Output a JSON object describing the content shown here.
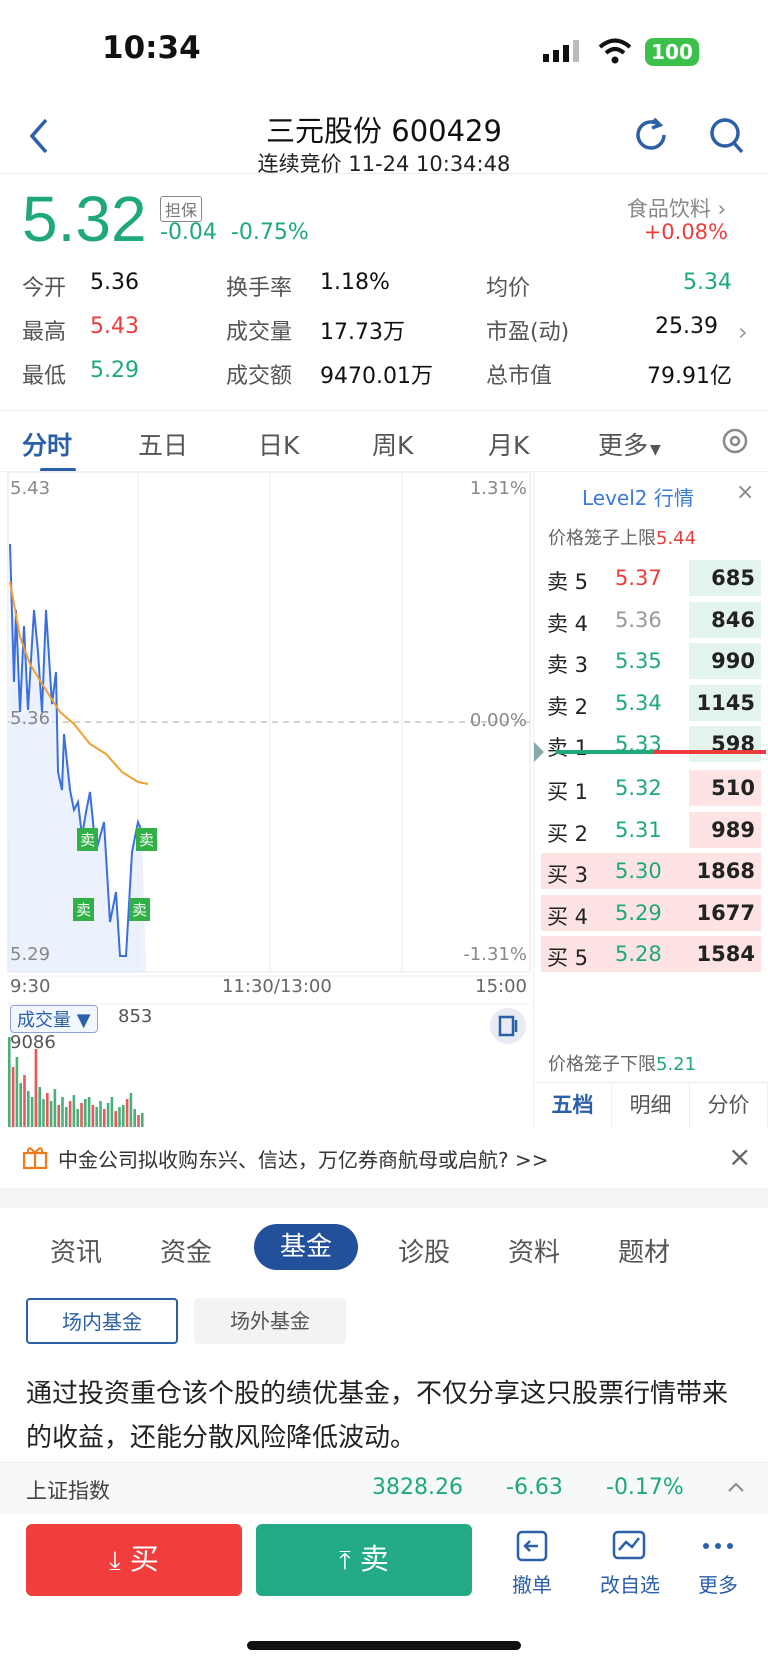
{
  "status": {
    "time": "10:34",
    "battery": "100"
  },
  "nav": {
    "title": "三元股份 600429",
    "subtitle": "连续竞价 11-24 10:34:48"
  },
  "quote": {
    "price": "5.32",
    "tag": "担保",
    "change": "-0.04",
    "change_pct": "-0.75%",
    "sector": "食品饮料",
    "sector_pct": "+0.08%"
  },
  "stats": [
    {
      "label": "今开",
      "value": "5.36",
      "color": "#111111"
    },
    {
      "label": "换手率",
      "value": "1.18%",
      "color": "#111111"
    },
    {
      "label": "均价",
      "value": "5.34",
      "color": "#1fa87a"
    },
    {
      "label": "最高",
      "value": "5.43",
      "color": "#ee3b3b"
    },
    {
      "label": "成交量",
      "value": "17.73万",
      "color": "#111111"
    },
    {
      "label": "市盈(动)",
      "value": "25.39",
      "color": "#111111"
    },
    {
      "label": "最低",
      "value": "5.29",
      "color": "#1fa87a"
    },
    {
      "label": "成交额",
      "value": "9470.01万",
      "color": "#111111"
    },
    {
      "label": "总市值",
      "value": "79.91亿",
      "color": "#111111"
    }
  ],
  "chart_tabs": [
    "分时",
    "五日",
    "日K",
    "周K",
    "月K",
    "更多"
  ],
  "chart": {
    "y_max": "5.43",
    "y_mid": "5.36",
    "y_min": "5.29",
    "pct_max": "1.31%",
    "pct_mid": "0.00%",
    "pct_min": "-1.31%",
    "t_start": "9:30",
    "t_mid": "11:30/13:00",
    "t_end": "15:00",
    "sell_mark": "卖",
    "vol_label": "成交量",
    "vol_value": "853",
    "vol_max": "9086"
  },
  "orderbook": {
    "title": "Level2 行情",
    "upper_label": "价格笼子上限",
    "upper": "5.44",
    "lower_label": "价格笼子下限",
    "lower": "5.21",
    "asks": [
      {
        "label": "卖 5",
        "price": "5.37",
        "vol": "685",
        "pc": "#ee3b3b"
      },
      {
        "label": "卖 4",
        "price": "5.36",
        "vol": "846",
        "pc": "#999999"
      },
      {
        "label": "卖 3",
        "price": "5.35",
        "vol": "990",
        "pc": "#1fa87a"
      },
      {
        "label": "卖 2",
        "price": "5.34",
        "vol": "1145",
        "pc": "#1fa87a"
      },
      {
        "label": "卖 1",
        "price": "5.33",
        "vol": "598",
        "pc": "#1fa87a"
      }
    ],
    "bids": [
      {
        "label": "买 1",
        "price": "5.32",
        "vol": "510"
      },
      {
        "label": "买 2",
        "price": "5.31",
        "vol": "989"
      },
      {
        "label": "买 3",
        "price": "5.30",
        "vol": "1868"
      },
      {
        "label": "买 4",
        "price": "5.29",
        "vol": "1677"
      },
      {
        "label": "买 5",
        "price": "5.28",
        "vol": "1584"
      }
    ],
    "tabs": [
      "五档",
      "明细",
      "分价"
    ]
  },
  "news": {
    "text": "中金公司拟收购东兴、信达，万亿券商航母或启航? >>"
  },
  "info_tabs": [
    "资讯",
    "资金",
    "基金",
    "诊股",
    "资料",
    "题材"
  ],
  "fund_tabs": [
    "场内基金",
    "场外基金"
  ],
  "fund_desc": "通过投资重仓该个股的绩优基金，不仅分享这只股票行情带来的收益，还能分散风险降低波动。",
  "index": {
    "name": "上证指数",
    "value": "3828.26",
    "change": "-6.63",
    "pct": "-0.17%"
  },
  "actions": {
    "buy": "买",
    "sell": "卖",
    "cancel": "撤单",
    "watch": "改自选",
    "more": "更多"
  },
  "colors": {
    "up": "#ee3b3b",
    "down": "#1fa87a",
    "accent": "#2b5fa8"
  }
}
